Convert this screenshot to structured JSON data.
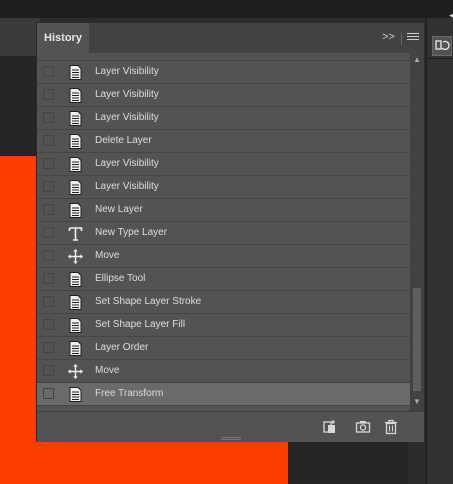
{
  "panel": {
    "tab_label": "History",
    "collapse_label": ">>"
  },
  "history": {
    "items": [
      {
        "label": "Layer Visibility",
        "icon": "document-icon"
      },
      {
        "label": "Layer Visibility",
        "icon": "document-icon"
      },
      {
        "label": "Layer Visibility",
        "icon": "document-icon"
      },
      {
        "label": "Delete Layer",
        "icon": "document-icon"
      },
      {
        "label": "Layer Visibility",
        "icon": "document-icon"
      },
      {
        "label": "Layer Visibility",
        "icon": "document-icon"
      },
      {
        "label": "New Layer",
        "icon": "document-icon"
      },
      {
        "label": "New Type Layer",
        "icon": "type-tool-icon"
      },
      {
        "label": "Move",
        "icon": "move-tool-icon"
      },
      {
        "label": "Ellipse Tool",
        "icon": "document-icon"
      },
      {
        "label": "Set Shape Layer Stroke",
        "icon": "document-icon"
      },
      {
        "label": "Set Shape Layer Fill",
        "icon": "document-icon"
      },
      {
        "label": "Layer Order",
        "icon": "document-icon"
      },
      {
        "label": "Move",
        "icon": "move-tool-icon"
      },
      {
        "label": "Free Transform",
        "icon": "document-icon",
        "selected": true
      }
    ]
  },
  "footer": {
    "buttons": [
      "create-document-from-state-icon",
      "snapshot-camera-icon",
      "trash-icon"
    ]
  },
  "colors": {
    "canvas": "#ff3d00",
    "panel_bg": "#535353",
    "selected_row": "#6a6a6a"
  }
}
